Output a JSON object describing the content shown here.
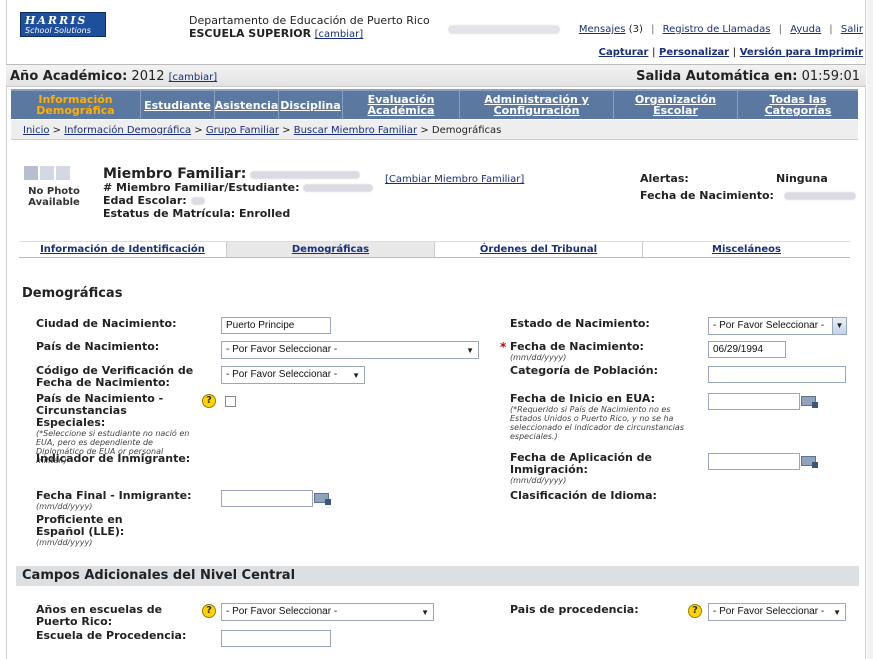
{
  "logo": {
    "line1": "HARRIS",
    "line2": "School Solutions"
  },
  "header": {
    "dept": "Departamento de Educación de Puerto Rico",
    "school": "ESCUELA SUPERIOR",
    "school_change": "[cambiar]",
    "messages_label": "Mensajes",
    "messages_count": "(3)",
    "calls": "Registro de Llamadas",
    "help": "Ayuda",
    "exit": "Salir",
    "capture": "Capturar",
    "customize": "Personalizar",
    "print": "Versión para Imprimir"
  },
  "yearbar": {
    "label": "Año Académico:",
    "year": "2012",
    "change": "[cambiar]",
    "timeout_label": "Salida Automática en:",
    "timeout": "01:59:01"
  },
  "nav": [
    {
      "l1": "Información",
      "l2": "Demográfica",
      "active": true
    },
    {
      "l1": "Estudiante",
      "l2": ""
    },
    {
      "l1": "Asistencia",
      "l2": ""
    },
    {
      "l1": "Disciplina",
      "l2": ""
    },
    {
      "l1": "Evaluación",
      "l2": "Académica"
    },
    {
      "l1": "Administración y",
      "l2": "Configuración"
    },
    {
      "l1": "Organización",
      "l2": "Escolar"
    },
    {
      "l1": "Todas las",
      "l2": "Categorías"
    }
  ],
  "crumbs": {
    "c1": "Inicio",
    "c2": "Información Demográfica",
    "c3": "Grupo Familiar",
    "c4": "Buscar Miembro Familiar",
    "c5": "Demográficas",
    "sep": " > "
  },
  "member": {
    "photo": "No Photo Available",
    "member_label": "Miembro Familiar:",
    "id_label": "# Miembro Familiar/Estudiante:",
    "age_label": "Edad Escolar:",
    "status_label": "Estatus de Matrícula:",
    "status": "Enrolled",
    "change": "[Cambiar Miembro Familiar]",
    "alerts_label": "Alertas:",
    "alerts": "Ninguna",
    "dob_label": "Fecha de Nacimiento:"
  },
  "tabs": [
    "Información de Identificación",
    "Demográficas",
    "Órdenes del Tribunal",
    "Misceláneos"
  ],
  "section": "Demográficas",
  "fields": {
    "city_label": "Ciudad de Nacimiento:",
    "city_value": "Puerto Principe",
    "country_label": "País de Nacimiento:",
    "country_value": "- Por Favor Seleccionar -",
    "verif_label": "Código de Verificación de Fecha de Nacimiento:",
    "verif_value": "- Por Favor Seleccionar -",
    "special_label": "País de Nacimiento - Circunstancias Especiales:",
    "special_hint": "(*Seleccione si estudiante no nació en EUA, pero es dependiente de Diplomático de EUA or personal militar.)",
    "immig_label": "Indicador de Inmigrante:",
    "immig_end_label": "Fecha Final - Inmigrante:",
    "date_hint": "(mm/dd/yyyy)",
    "spanish_label": "Proficiente en Español (LLE):",
    "state_label": "Estado de Nacimiento:",
    "state_value": "- Por Favor Seleccionar -",
    "dob_label": "Fecha de Nacimiento:",
    "dob_value": "06/29/1994",
    "population_label": "Categoría de Población:",
    "us_start_label": "Fecha de Inicio en EUA:",
    "us_start_hint": "(*Requerido si País de Nacimiento no es Estados Unidos o Puerto Rico, y no se ha seleccionado el indicador de circunstancias especiales.)",
    "immig_apply_label": "Fecha de Aplicación de Inmigración:",
    "language_label": "Clasificación de Idioma:"
  },
  "central": {
    "title": "Campos Adicionales del Nivel Central",
    "years_label": "Años en escuelas de Puerto Rico:",
    "years_value": "- Por Favor Seleccionar -",
    "origin_school_label": "Escuela de Procedencia:",
    "origin_country_label": "Pais de procedencia:",
    "origin_country_value": "- Por Favor Seleccionar -"
  }
}
